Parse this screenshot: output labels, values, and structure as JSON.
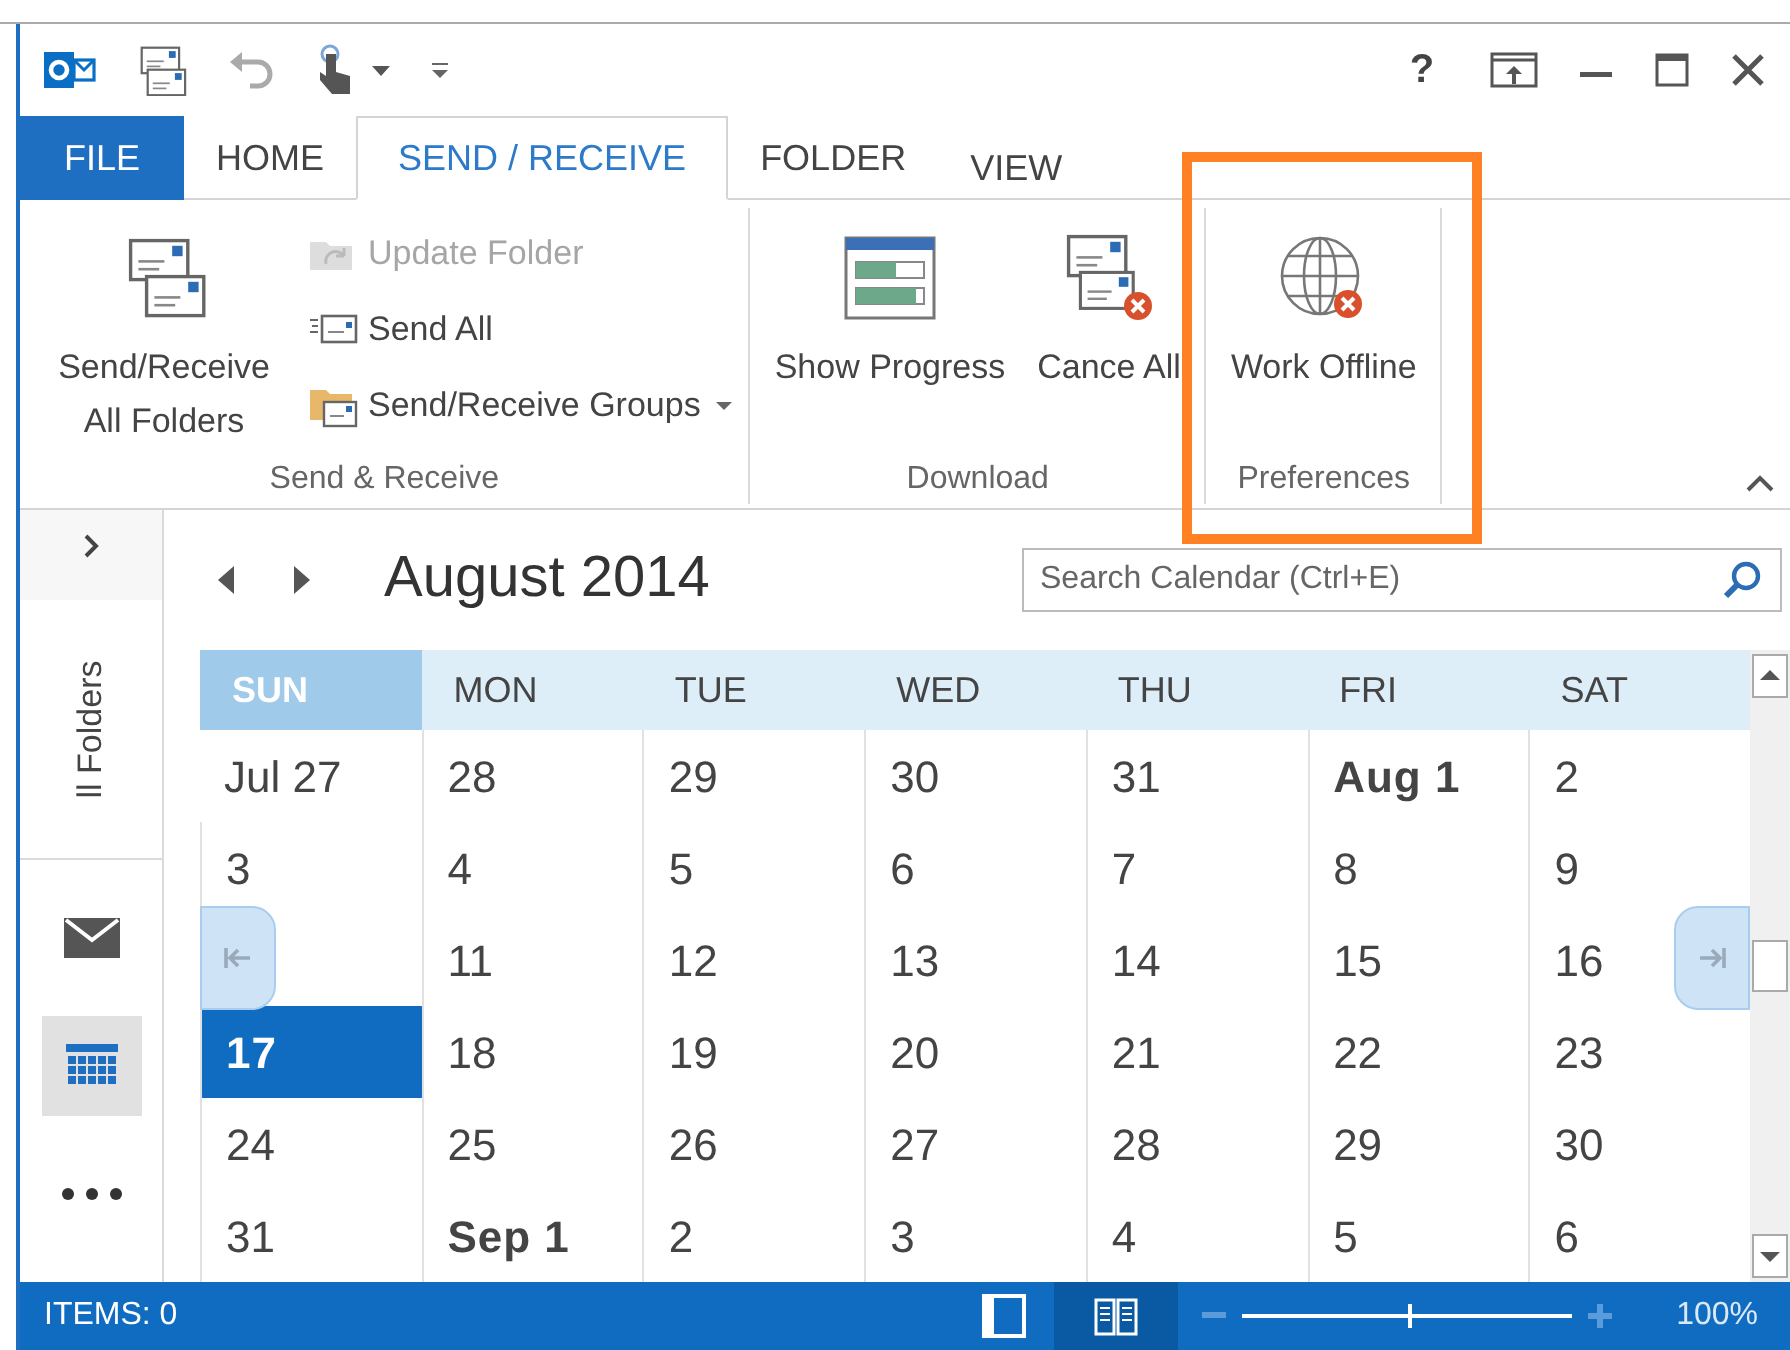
{
  "window": {
    "controls": [
      "?"
    ]
  },
  "tabs": [
    {
      "label": "FILE",
      "kind": "file",
      "selected": false
    },
    {
      "label": "HOME",
      "kind": "tab",
      "selected": false
    },
    {
      "label": "SEND / RECEIVE",
      "kind": "tab",
      "selected": true
    },
    {
      "label": "FOLDER",
      "kind": "tab",
      "selected": false
    },
    {
      "label": "VIEW",
      "kind": "tab",
      "selected": false
    }
  ],
  "ribbon": {
    "groups": [
      {
        "label": "Send & Receive",
        "items": [
          {
            "kind": "large",
            "label": "Send/Receive All Folders",
            "disabled": false
          },
          {
            "kind": "small",
            "label": "Update Folder",
            "disabled": true
          },
          {
            "kind": "small",
            "label": "Send All",
            "disabled": false
          },
          {
            "kind": "small",
            "label": "Send/Receive Groups",
            "dropdown": true,
            "disabled": false
          }
        ]
      },
      {
        "label": "Download",
        "items": [
          {
            "kind": "large",
            "label": "Show Progress",
            "disabled": false
          },
          {
            "kind": "large",
            "label": "Cance All",
            "disabled": false
          }
        ]
      },
      {
        "label": "Preferences",
        "highlighted": true,
        "items": [
          {
            "kind": "large",
            "label": "Work Offline",
            "disabled": false
          }
        ]
      }
    ]
  },
  "nav": {
    "folders_label": "ll Folders",
    "items": [
      {
        "selected": false
      },
      {
        "selected": true
      },
      {
        "selected": false
      }
    ]
  },
  "calendar": {
    "title": "August 2014",
    "search": {
      "placeholder": "Search Calendar (Ctrl+E)"
    },
    "days": [
      {
        "label": "SUN",
        "selected": true
      },
      {
        "label": "MON",
        "selected": false
      },
      {
        "label": "TUE",
        "selected": false
      },
      {
        "label": "WED",
        "selected": false
      },
      {
        "label": "THU",
        "selected": false
      },
      {
        "label": "FRI",
        "selected": false
      },
      {
        "label": "SAT",
        "selected": false
      }
    ],
    "weeks": [
      [
        {
          "text": "Jul 27",
          "bold": false,
          "selected": false
        },
        {
          "text": "28",
          "bold": false,
          "selected": false
        },
        {
          "text": "29",
          "bold": false,
          "selected": false
        },
        {
          "text": "30",
          "bold": false,
          "selected": false
        },
        {
          "text": "31",
          "bold": false,
          "selected": false
        },
        {
          "text": "Aug 1",
          "bold": true,
          "selected": false
        },
        {
          "text": "2",
          "bold": false,
          "selected": false
        }
      ],
      [
        {
          "text": "3",
          "bold": false,
          "selected": false
        },
        {
          "text": "4",
          "bold": false,
          "selected": false
        },
        {
          "text": "5",
          "bold": false,
          "selected": false
        },
        {
          "text": "6",
          "bold": false,
          "selected": false
        },
        {
          "text": "7",
          "bold": false,
          "selected": false
        },
        {
          "text": "8",
          "bold": false,
          "selected": false
        },
        {
          "text": "9",
          "bold": false,
          "selected": false
        }
      ],
      [
        {
          "selected": false
        },
        {
          "text": "11",
          "bold": false,
          "selected": false
        },
        {
          "text": "12",
          "bold": false,
          "selected": false
        },
        {
          "text": "13",
          "bold": false,
          "selected": false
        },
        {
          "text": "14",
          "bold": false,
          "selected": false
        },
        {
          "text": "15",
          "bold": false,
          "selected": false
        },
        {
          "text": "16",
          "bold": false,
          "selected": false
        }
      ],
      [
        {
          "text": "17",
          "bold": true,
          "selected": true
        },
        {
          "text": "18",
          "bold": false,
          "selected": false
        },
        {
          "text": "19",
          "bold": false,
          "selected": false
        },
        {
          "text": "20",
          "bold": false,
          "selected": false
        },
        {
          "text": "21",
          "bold": false,
          "selected": false
        },
        {
          "text": "22",
          "bold": false,
          "selected": false
        },
        {
          "text": "23",
          "bold": false,
          "selected": false
        }
      ],
      [
        {
          "text": "24",
          "bold": false,
          "selected": false
        },
        {
          "text": "25",
          "bold": false,
          "selected": false
        },
        {
          "text": "26",
          "bold": false,
          "selected": false
        },
        {
          "text": "27",
          "bold": false,
          "selected": false
        },
        {
          "text": "28",
          "bold": false,
          "selected": false
        },
        {
          "text": "29",
          "bold": false,
          "selected": false
        },
        {
          "text": "30",
          "bold": false,
          "selected": false
        }
      ],
      [
        {
          "text": "31",
          "bold": false,
          "selected": false
        },
        {
          "text": "Sep 1",
          "bold": true,
          "selected": false
        },
        {
          "text": "2",
          "bold": false,
          "selected": false
        },
        {
          "text": "3",
          "bold": false,
          "selected": false
        },
        {
          "text": "4",
          "bold": false,
          "selected": false
        },
        {
          "text": "5",
          "bold": false,
          "selected": false
        },
        {
          "text": "6",
          "bold": false,
          "selected": false
        }
      ]
    ]
  },
  "status_bar": {
    "items": "ITEMS: 0",
    "zoom": {
      "level": 0.5,
      "reading": "100%"
    }
  }
}
